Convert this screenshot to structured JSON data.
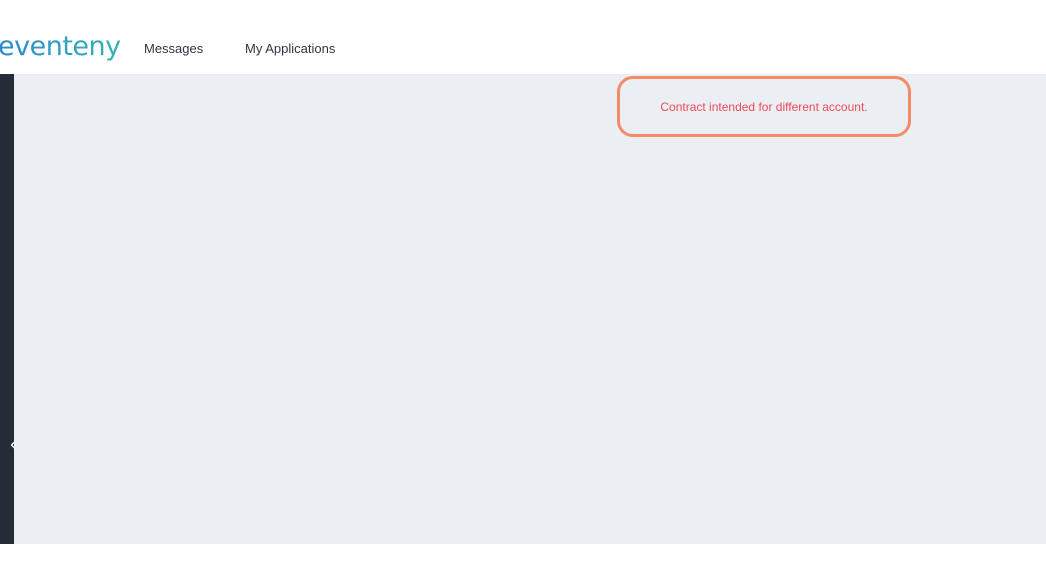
{
  "header": {
    "logo_text": "eventeny",
    "nav": [
      {
        "label": "Messages"
      },
      {
        "label": "My Applications"
      }
    ]
  },
  "notice": {
    "message": "Contract intended for different account."
  },
  "sidebar": {
    "toggle_icon": "chevron-left-icon"
  },
  "colors": {
    "brand_start": "#2a88c8",
    "brand_end": "#35b2b5",
    "notice_border": "#f58a68",
    "notice_text": "#ef4a5a",
    "sidebar": "#262c37",
    "main_background": "#ebeef2"
  }
}
